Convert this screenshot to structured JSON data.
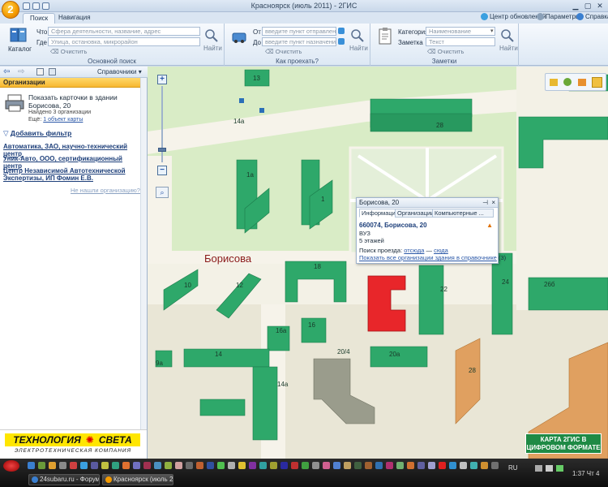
{
  "window": {
    "title": "Красноярск (июль 2011) - 2ГИС",
    "logo": "2",
    "tabs": [
      "Поиск",
      "Навигация"
    ],
    "top_links": [
      "Центр обновлений",
      "Параметры",
      "Справка"
    ]
  },
  "ribbon": {
    "catalog_label": "Каталог",
    "basic_search": {
      "what_label": "Что",
      "what_placeholder": "Сфера деятельности, название, адрес",
      "where_label": "Где",
      "where_placeholder": "Улица, остановка, микрорайон",
      "clear": "Очистить",
      "find": "Найти",
      "group_label": "Основной поиск"
    },
    "route": {
      "from_label": "От",
      "from_placeholder": "введите пункт отправления",
      "to_label": "До",
      "to_placeholder": "введите пункт назначения",
      "clear": "Очистить",
      "find": "Найти",
      "group_label": "Как проехать?"
    },
    "notes": {
      "category_label": "Категория",
      "category_placeholder": "Наименование",
      "note_label": "Заметка",
      "note_placeholder": "Текст",
      "clear": "Очистить",
      "find": "Найти",
      "group_label": "Заметки"
    }
  },
  "left_panel": {
    "toolbar_label": "Справочники",
    "header": "Организации",
    "card": {
      "title_line1": "Показать карточки в здании",
      "title_line2": "Борисова, 20",
      "found": "Найдено 3 организации",
      "hint_prefix": "Ещё:",
      "hint_link": "1 объект карты"
    },
    "add_filter": "Добавить фильтр",
    "orgs": [
      "Автоматика, ЗАО, научно-технический центр",
      "Уник-Авто, ООО, сертификационный центр",
      "Центр Независимой Автотехнической Экспертизы, ИП Фомин Е.В."
    ],
    "not_found": "Не нашли организацию?"
  },
  "ad": {
    "brand_line1": "ТЕХНОЛОГИЯ",
    "brand_line2": "СВЕТА",
    "subtitle": "ЭЛЕКТРОТЕХНИЧЕСКАЯ КОМПАНИЯ"
  },
  "map": {
    "street_label": "Борисова",
    "numbers": [
      "13",
      "28",
      "1а",
      "1",
      "14а",
      "18",
      "10",
      "12",
      "22",
      "24",
      "26б",
      "16а",
      "16",
      "14",
      "9а",
      "20/4",
      "20а",
      "14а",
      "28"
    ],
    "promo_line1": "КАРТА 2ГИС В",
    "promo_line2": "ЦИФРОВОМ ФОРМАТЕ"
  },
  "popup": {
    "title": "Борисова, 20",
    "tabs": [
      "Информация",
      "Организации",
      "Компьютерные ..."
    ],
    "address": "660074, Борисова, 20",
    "type": "ВУЗ",
    "floors": "5 этажей",
    "route_prefix": "Поиск проезда:",
    "route_from": "отсюда",
    "route_dash": "—",
    "route_to": "сюда",
    "show_all": "Показать все организации здания в справочнике",
    "show_all_count": "(3)"
  },
  "taskbar": {
    "tasks": [
      "24subaru.ru - Форум ...",
      "Красноярск (июль 20..."
    ],
    "lang": "RU",
    "clock": "1:37 Чт 4"
  },
  "colors": {
    "building": "#2ea86a",
    "selected_building": "#e8262a",
    "road": "#f6f3ea",
    "park": "#d9ecc6",
    "orange_building": "#e0a060"
  }
}
